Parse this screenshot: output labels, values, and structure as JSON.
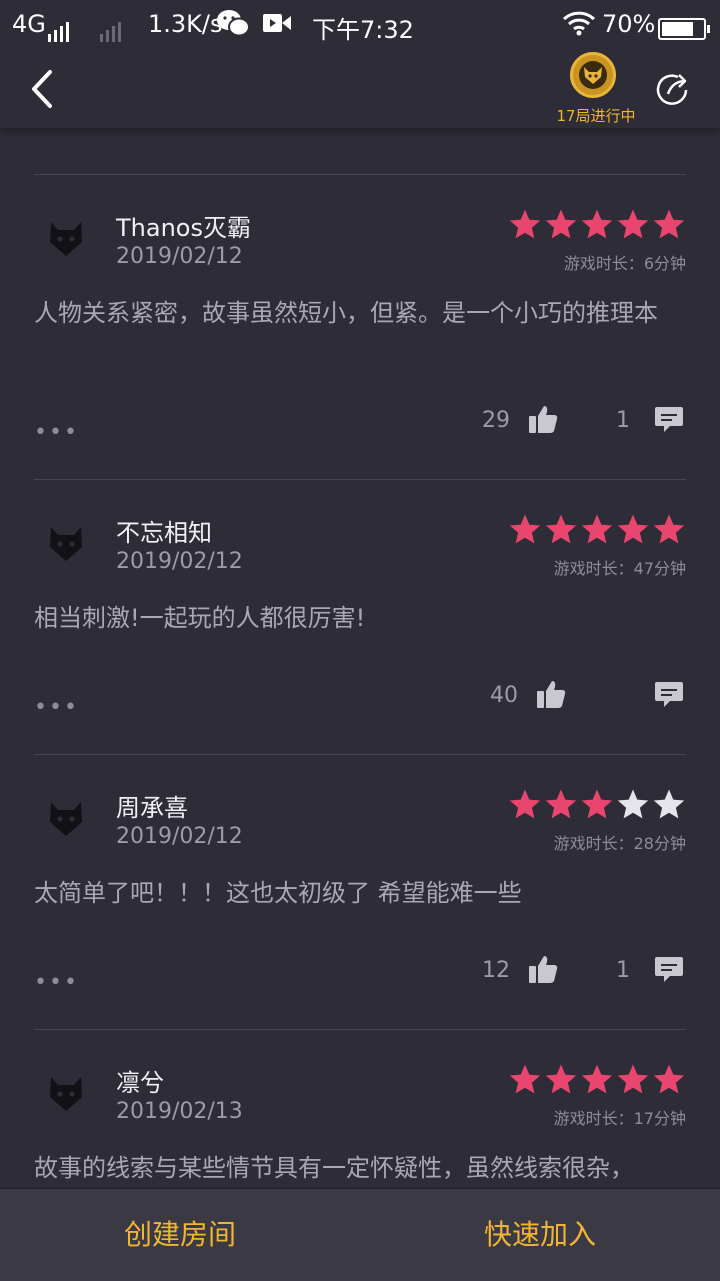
{
  "status_bar": {
    "network": "4G",
    "speed": "1.3K/s",
    "time": "下午7:32",
    "battery": "70%",
    "icons": [
      "signal-icon",
      "wechat-icon",
      "video-icon",
      "wifi-icon",
      "battery-icon"
    ]
  },
  "header": {
    "back_icon": "chevron-left-icon",
    "games_in_progress": "17局进行中",
    "share_icon": "share-icon"
  },
  "reviews": [
    {
      "user": "Thanos灭霸",
      "date": "2019/02/12",
      "rating": 5,
      "playtime": "游戏时长：6分钟",
      "content": "人物关系紧密，故事虽然短小，但紧。是一个小巧的推理本",
      "likes": "29",
      "comments": "1"
    },
    {
      "user": "不忘相知",
      "date": "2019/02/12",
      "rating": 5,
      "playtime": "游戏时长：47分钟",
      "content": "相当刺激!一起玩的人都很厉害!",
      "likes": "40",
      "comments": ""
    },
    {
      "user": "周承喜",
      "date": "2019/02/12",
      "rating": 3,
      "playtime": "游戏时长：28分钟",
      "content": "太简单了吧！！！这也太初级了 希望能难一些",
      "likes": "12",
      "comments": "1"
    },
    {
      "user": "凛兮",
      "date": "2019/02/13",
      "rating": 5,
      "playtime": "游戏时长：17分钟",
      "content": "故事的线索与某些情节具有一定怀疑性，虽然线索很杂，",
      "likes": "",
      "comments": ""
    }
  ],
  "more_label": "•••",
  "bottom": {
    "create_room": "创建房间",
    "quick_join": "快速加入"
  },
  "colors": {
    "background": "#2d2c37",
    "star_filled": "#e8466e",
    "star_empty": "#e4e4ea",
    "accent": "#f0b533"
  }
}
